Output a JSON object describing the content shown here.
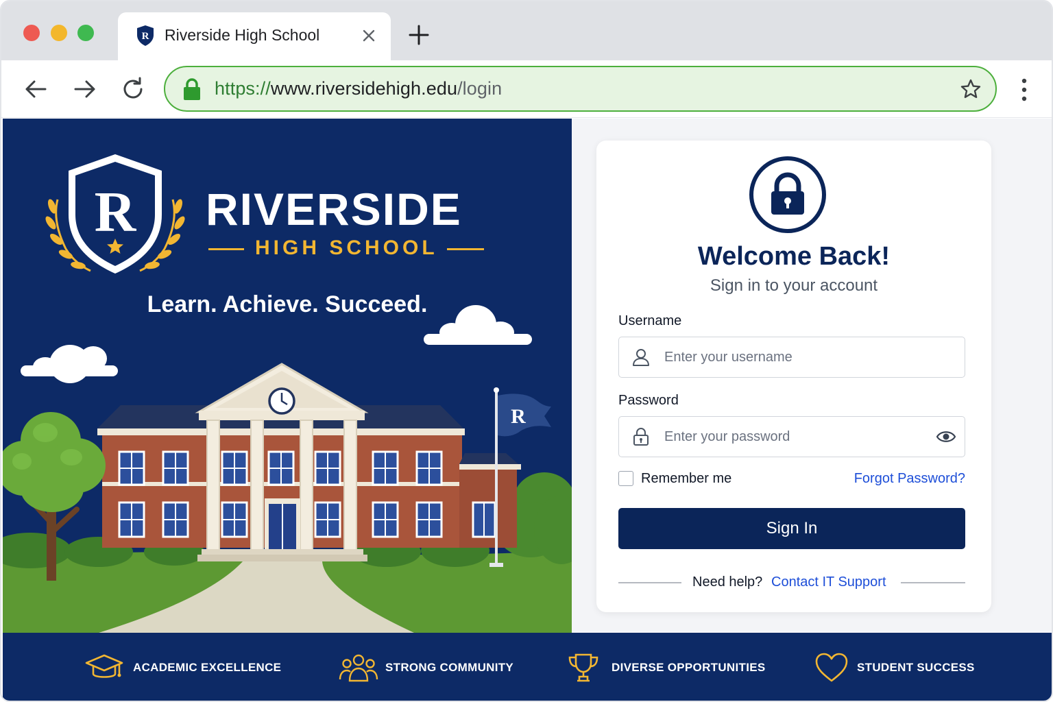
{
  "browser": {
    "tab_title": "Riverside High School",
    "url_protocol": "https://",
    "url_host": "www.riversidehigh.edu",
    "url_path": "/login"
  },
  "hero": {
    "logo_letter": "R",
    "brand_name": "RIVERSIDE",
    "brand_subtitle": "HIGH SCHOOL",
    "tagline": "Learn. Achieve. Succeed.",
    "flag_letter": "R"
  },
  "login": {
    "title": "Welcome Back!",
    "subtitle": "Sign in to your account",
    "username_label": "Username",
    "username_placeholder": "Enter your username",
    "password_label": "Password",
    "password_placeholder": "Enter your password",
    "remember_label": "Remember me",
    "forgot_label": "Forgot Password?",
    "signin_label": "Sign In",
    "help_text": "Need help?",
    "help_link": "Contact IT Support"
  },
  "footer": {
    "features": [
      {
        "label": "ACADEMIC EXCELLENCE",
        "icon": "graduation-cap-icon"
      },
      {
        "label": "STRONG COMMUNITY",
        "icon": "people-icon"
      },
      {
        "label": "DIVERSE OPPORTUNITIES",
        "icon": "trophy-icon"
      },
      {
        "label": "STUDENT SUCCESS",
        "icon": "heart-icon"
      }
    ]
  },
  "colors": {
    "navy": "#0d2a66",
    "gold": "#f2b632",
    "link_blue": "#1d4ed8",
    "secure_green": "#2e7d32"
  }
}
